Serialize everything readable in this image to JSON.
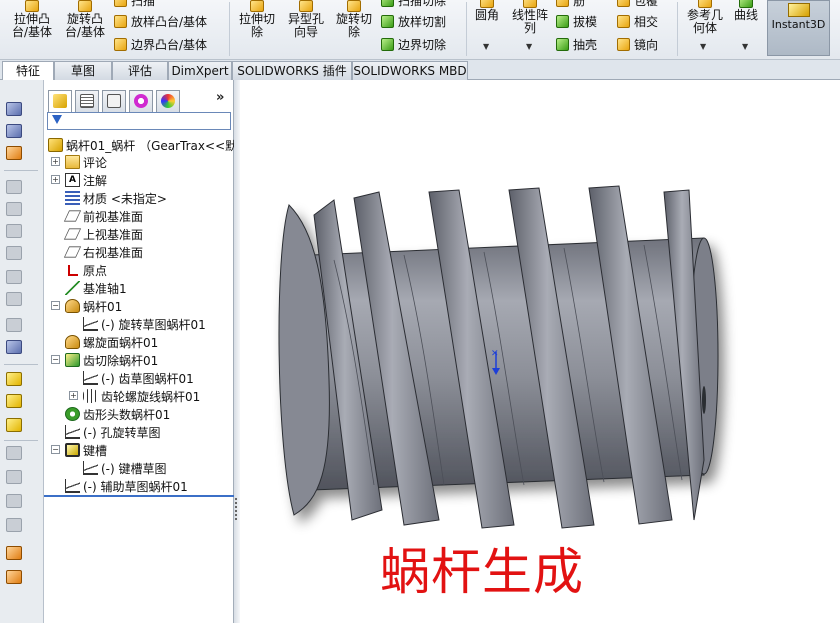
{
  "ribbon": {
    "extrude_boss": "拉伸凸\n台/基体",
    "revolve_boss": "旋转凸\n台/基体",
    "sweep_boss": "扫描",
    "loft_boss": "放样凸台/基体",
    "boundary_boss": "边界凸台/基体",
    "extrude_cut": "拉伸切\n除",
    "hole_wizard": "异型孔\n向导",
    "revolve_cut": "旋转切\n除",
    "swept_cut": "扫描切除",
    "lofted_cut": "放样切割",
    "boundary_cut": "边界切除",
    "fillet": "圆角",
    "linear_pattern": "线性阵\n列",
    "rib": "筋",
    "draft": "拔模",
    "shell": "抽壳",
    "wrap": "包覆",
    "intersect": "相交",
    "mirror": "镜向",
    "ref_geometry": "参考几\n何体",
    "curves": "曲线",
    "instant3d": "Instant3D"
  },
  "tabs": [
    "特征",
    "草图",
    "评估",
    "DimXpert",
    "SOLIDWORKS 插件",
    "SOLIDWORKS MBD"
  ],
  "tree": {
    "root": "蜗杆01_蜗杆 （GearTrax<<默",
    "items": [
      "评论",
      "注解",
      "材质 <未指定>",
      "前视基准面",
      "上视基准面",
      "右视基准面",
      "原点",
      "基准轴1",
      "蜗杆01",
      "(-) 旋转草图蜗杆01",
      "螺旋面蜗杆01",
      "齿切除蜗杆01",
      "(-) 齿草图蜗杆01",
      "齿轮螺旋线蜗杆01",
      "齿形头数蜗杆01",
      "(-) 孔旋转草图",
      "键槽",
      "(-) 键槽草图",
      "(-) 辅助草图蜗杆01"
    ]
  },
  "viewport": {
    "caption": "蜗杆生成"
  },
  "colors": {
    "caption": "#e21212",
    "worm_body": "#8f929c"
  }
}
